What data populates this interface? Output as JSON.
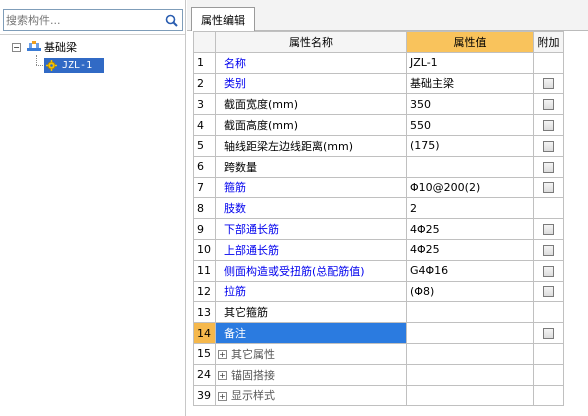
{
  "search": {
    "placeholder": "搜索构件..."
  },
  "tree": {
    "root_label": "基础梁",
    "expander": "−",
    "child_label": "JZL-1"
  },
  "tab": {
    "label": "属性编辑"
  },
  "table": {
    "headers": {
      "name": "属性名称",
      "value": "属性值",
      "add": "附加"
    },
    "rows": [
      {
        "num": "1",
        "name": "名称",
        "value": "JZL-1",
        "color": "blue",
        "checkbox": false,
        "expandable": false
      },
      {
        "num": "2",
        "name": "类别",
        "value": "基础主梁",
        "color": "blue",
        "checkbox": true,
        "expandable": false
      },
      {
        "num": "3",
        "name": "截面宽度(mm)",
        "value": "350",
        "color": "black",
        "checkbox": true,
        "expandable": false
      },
      {
        "num": "4",
        "name": "截面高度(mm)",
        "value": "550",
        "color": "black",
        "checkbox": true,
        "expandable": false
      },
      {
        "num": "5",
        "name": "轴线距梁左边线距离(mm)",
        "value": "(175)",
        "color": "black",
        "checkbox": true,
        "expandable": false
      },
      {
        "num": "6",
        "name": "跨数量",
        "value": "",
        "color": "black",
        "checkbox": true,
        "expandable": false
      },
      {
        "num": "7",
        "name": "箍筋",
        "value": "Φ10@200(2)",
        "color": "blue",
        "checkbox": true,
        "expandable": false
      },
      {
        "num": "8",
        "name": "肢数",
        "value": "2",
        "color": "blue",
        "checkbox": false,
        "expandable": false
      },
      {
        "num": "9",
        "name": "下部通长筋",
        "value": "4Φ25",
        "color": "blue",
        "checkbox": true,
        "expandable": false
      },
      {
        "num": "10",
        "name": "上部通长筋",
        "value": "4Φ25",
        "color": "blue",
        "checkbox": true,
        "expandable": false
      },
      {
        "num": "11",
        "name": "侧面构造或受扭筋(总配筋值)",
        "value": "G4Φ16",
        "color": "blue",
        "checkbox": true,
        "expandable": false
      },
      {
        "num": "12",
        "name": "拉筋",
        "value": "(Φ8)",
        "color": "blue",
        "checkbox": true,
        "expandable": false
      },
      {
        "num": "13",
        "name": "其它箍筋",
        "value": "",
        "color": "black",
        "checkbox": false,
        "expandable": false
      },
      {
        "num": "14",
        "name": "备注",
        "value": "",
        "color": "black",
        "checkbox": true,
        "expandable": false,
        "selected": true
      },
      {
        "num": "15",
        "name": "其它属性",
        "value": "",
        "color": "gray",
        "checkbox": false,
        "expandable": true
      },
      {
        "num": "24",
        "name": "锚固搭接",
        "value": "",
        "color": "gray",
        "checkbox": false,
        "expandable": true
      },
      {
        "num": "39",
        "name": "显示样式",
        "value": "",
        "color": "gray",
        "checkbox": false,
        "expandable": true
      }
    ]
  },
  "colors": {
    "selection_blue": "#2b7be0",
    "header_orange": "#f9c35c",
    "link_blue": "#0000ee"
  },
  "icons": {
    "search": "search-icon",
    "root": "beam-group-icon",
    "child": "beam-gear-icon",
    "expand": "plus-expander-icon"
  }
}
